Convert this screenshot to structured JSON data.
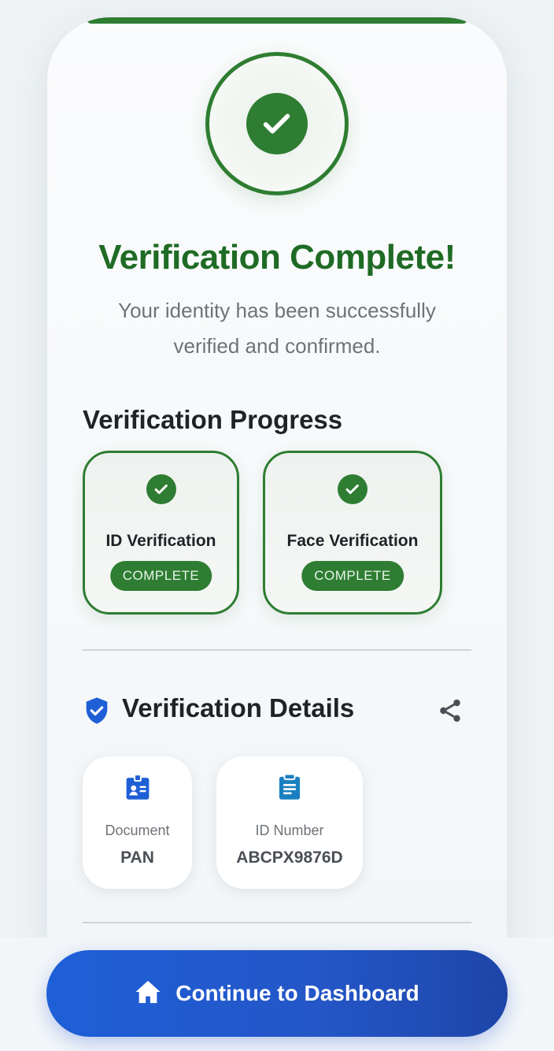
{
  "hero": {
    "icon": "check-circle-icon",
    "title": "Verification Complete!",
    "subtitle": "Your identity has been successfully verified and confirmed."
  },
  "progress": {
    "section_title": "Verification Progress",
    "steps": [
      {
        "label": "ID Verification",
        "status": "COMPLETE",
        "icon": "check-circle-icon"
      },
      {
        "label": "Face Verification",
        "status": "COMPLETE",
        "icon": "check-circle-icon"
      }
    ]
  },
  "details": {
    "section_title": "Verification Details",
    "title_icon": "shield-check-icon",
    "action_icon": "share-icon",
    "items": [
      {
        "icon": "id-badge-icon",
        "label": "Document",
        "value": "PAN"
      },
      {
        "icon": "clipboard-icon",
        "label": "ID Number",
        "value": "ABCPX9876D"
      }
    ]
  },
  "cta": {
    "icon": "home-icon",
    "label": "Continue to Dashboard"
  },
  "colors": {
    "success": "#2e7d32",
    "title_green": "#1f6b25",
    "primary_blue": "#1e5fd8",
    "text_dark": "#1f2328",
    "text_muted": "#6e7378"
  }
}
